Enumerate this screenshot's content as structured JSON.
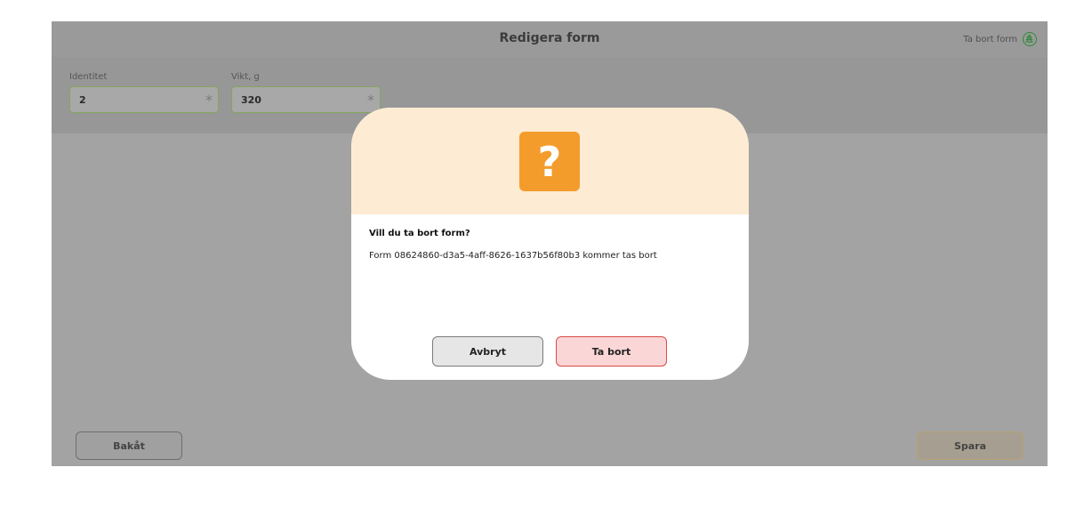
{
  "header": {
    "title": "Redigera form",
    "delete_label": "Ta bort form",
    "delete_icon": "tree-icon"
  },
  "form": {
    "fields": [
      {
        "label": "Identitet",
        "value": "2",
        "required_mark": "*"
      },
      {
        "label": "Vikt, g",
        "value": "320",
        "required_mark": "*"
      }
    ]
  },
  "footer": {
    "back_label": "Bakåt",
    "save_label": "Spara"
  },
  "dialog": {
    "icon": "question-icon",
    "icon_glyph": "?",
    "heading": "Vill du ta bort form?",
    "message": "Form 08624860-d3a5-4aff-8626-1637b56f80b3 kommer tas bort",
    "cancel_label": "Avbryt",
    "confirm_label": "Ta bort",
    "colors": {
      "accent": "#f39c2b",
      "danger": "#d84a4a"
    }
  }
}
